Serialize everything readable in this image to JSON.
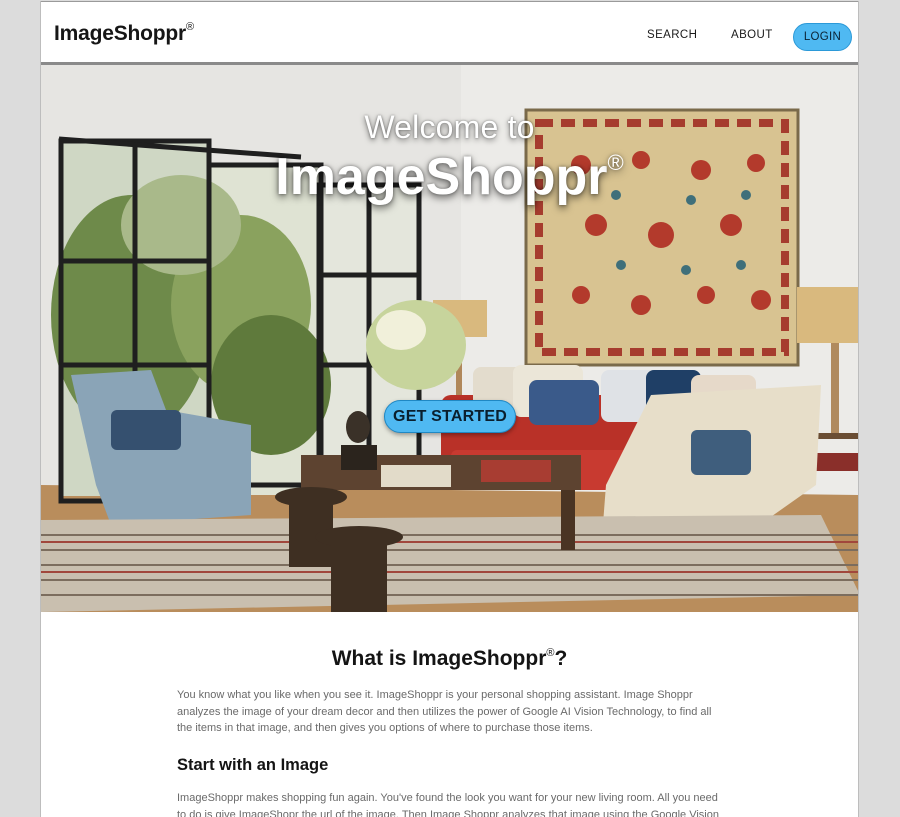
{
  "nav": {
    "brand": "ImageShoppr",
    "brand_mark": "®",
    "links": [
      "SEARCH",
      "ABOUT"
    ],
    "login_label": "LOGIN"
  },
  "hero": {
    "welcome": "Welcome to",
    "title": "ImageShoppr",
    "title_mark": "®",
    "cta_label": "GET STARTED",
    "image_icon": "living-room-photo"
  },
  "section_about": {
    "heading": "What is ImageShoppr",
    "heading_mark": "®",
    "heading_suffix": "?",
    "body": "You know what you like when you see it. ImageShoppr is your personal shopping assistant. Image Shoppr analyzes the image of your dream decor and then utilizes the power of Google AI Vision Technology, to find all the items in that image, and then gives you options of where to purchase those items."
  },
  "section_start": {
    "heading": "Start with an Image",
    "body": "ImageShoppr makes shopping fun again. You've found the look you want for your new living room. All you need to do is give ImageShopr the url of the image. Then Image Shoppr analyzes that image using the Google Vision"
  },
  "colors": {
    "accent": "#4fb9f2",
    "text_dark": "#141414",
    "text_body": "#6a6a6a"
  }
}
